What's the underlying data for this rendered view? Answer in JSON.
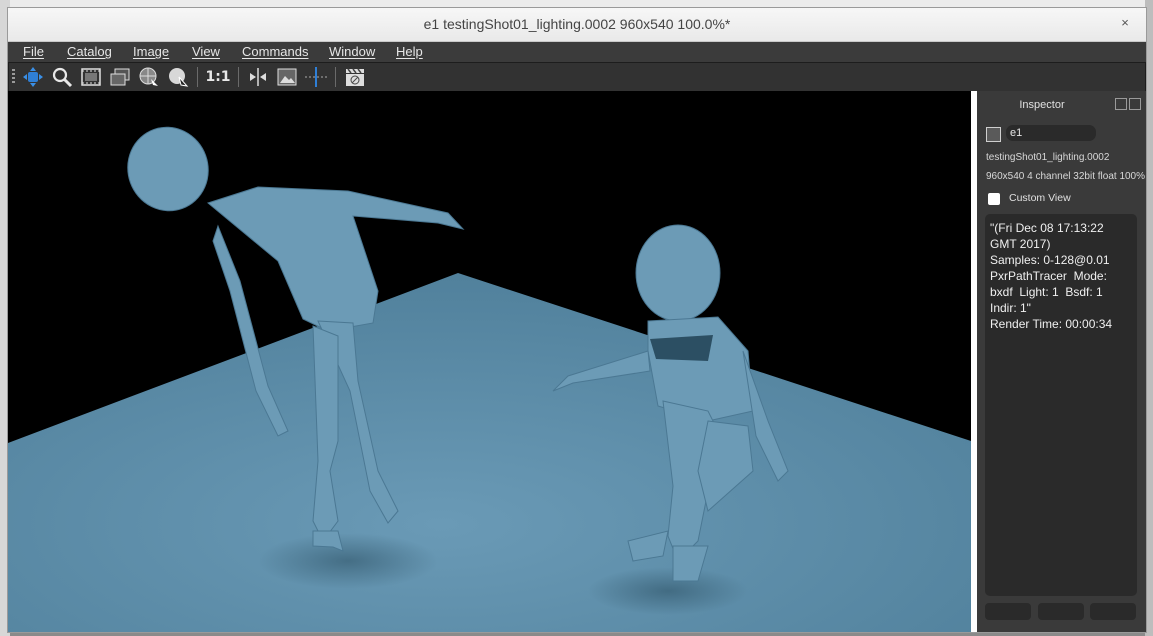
{
  "window": {
    "title": "e1 testingShot01_lighting.0002 960x540 100.0%*",
    "close_glyph": "×"
  },
  "menu": {
    "items": [
      "File",
      "Catalog",
      "Image",
      "View",
      "Commands",
      "Window",
      "Help"
    ]
  },
  "toolbar": {
    "tools": [
      {
        "icon": "pan-move-icon"
      },
      {
        "icon": "zoom-icon"
      },
      {
        "icon": "film-frame-icon"
      },
      {
        "icon": "film-stack-icon"
      },
      {
        "icon": "globe-pick-icon"
      },
      {
        "icon": "sphere-pick-icon"
      },
      {
        "icon": "one-to-one-icon"
      },
      {
        "icon": "flip-horizontal-icon"
      },
      {
        "icon": "image-view-icon"
      },
      {
        "icon": "guide-line-icon"
      },
      {
        "icon": "clapper-icon"
      }
    ],
    "one_to_one_label": "1:1",
    "accent": "#2f7fd6"
  },
  "inspector": {
    "title": "Inspector",
    "image_name": "e1",
    "image_file": "testingShot01_lighting.0002",
    "image_info": "960x540 4 channel 32bit float 100%",
    "custom_view_label": "Custom View",
    "custom_view_checked": false,
    "notes": [
      "\"(Fri Dec 08 17:13:22",
      "GMT 2017)",
      "Samples: 0-128@0.01",
      "PxrPathTracer  Mode:",
      "bxdf  Light: 1  Bsdf: 1",
      "Indir: 1\"",
      "Render Time: 00:00:34"
    ]
  },
  "render": {
    "background": "#000000",
    "floor_color": "#5f8ea9",
    "figure_color": "#6c9bb6"
  }
}
